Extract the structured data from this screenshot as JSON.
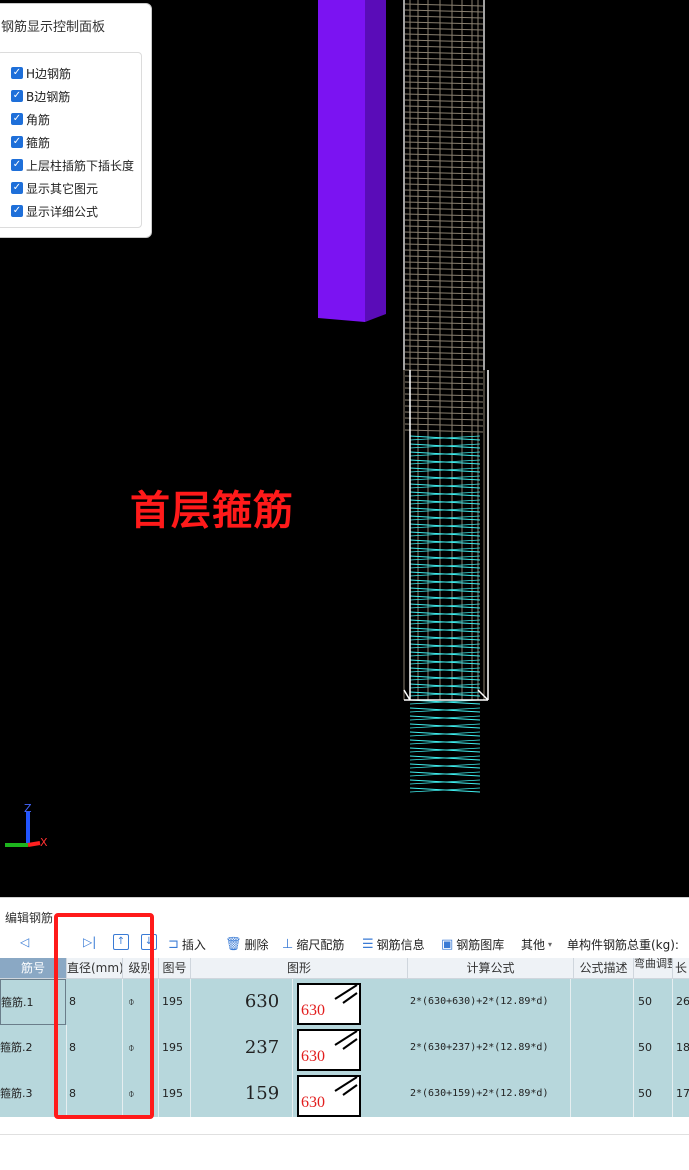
{
  "control_panel": {
    "title": "钢筋显示控制面板",
    "options": [
      {
        "label": "H边钢筋",
        "checked": true
      },
      {
        "label": "B边钢筋",
        "checked": true
      },
      {
        "label": "角筋",
        "checked": true
      },
      {
        "label": "箍筋",
        "checked": true
      },
      {
        "label": "上层柱插筋下插长度",
        "checked": true
      },
      {
        "label": "显示其它图元",
        "checked": true
      },
      {
        "label": "显示详细公式",
        "checked": true
      }
    ]
  },
  "viewport": {
    "annotation": "首层箍筋",
    "axes": {
      "z": "Z",
      "x": "X"
    },
    "colors": {
      "annotation": "#ff1a1a",
      "column": "#7b13f2",
      "stirrup": "#3ff0f0",
      "cage": "#8a8070"
    }
  },
  "editor": {
    "title": "编辑钢筋",
    "toolbar": {
      "insert": "插入",
      "delete": "删除",
      "scale": "缩尺配筋",
      "info": "钢筋信息",
      "library": "钢筋图库",
      "other": "其他",
      "total_weight": "单构件钢筋总重(kg):"
    },
    "columns": [
      "筋号",
      "直径(mm)",
      "级别",
      "图号",
      "图形",
      "计算公式",
      "公式描述",
      "弯曲调整",
      "长"
    ],
    "rows": [
      {
        "name": "箍筋.1",
        "diameter": "8",
        "grade": "⌽",
        "fig": "195",
        "dim": "630",
        "shape_label": "630",
        "formula": "2*(630+630)+2*(12.89*d)",
        "bend": "50",
        "length": "26"
      },
      {
        "name": "箍筋.2",
        "diameter": "8",
        "grade": "⌽",
        "fig": "195",
        "dim": "237",
        "shape_label": "630",
        "formula": "2*(630+237)+2*(12.89*d)",
        "bend": "50",
        "length": "18"
      },
      {
        "name": "箍筋.3",
        "diameter": "8",
        "grade": "⌽",
        "fig": "195",
        "dim": "159",
        "shape_label": "630",
        "formula": "2*(630+159)+2*(12.89*d)",
        "bend": "50",
        "length": "17"
      }
    ]
  }
}
